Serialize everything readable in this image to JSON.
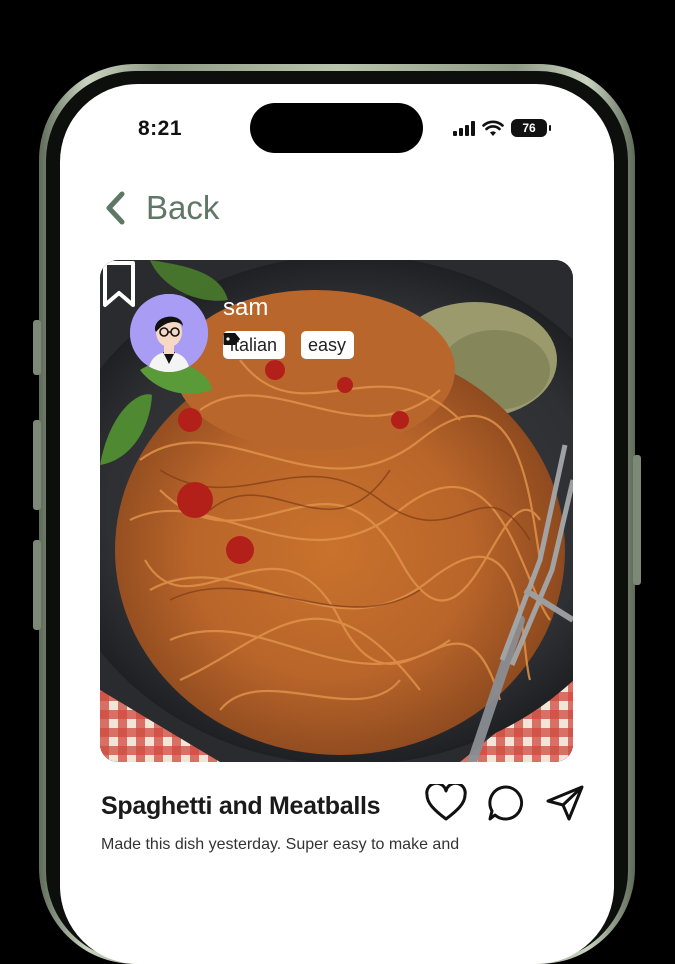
{
  "status_bar": {
    "time": "8:21",
    "battery_level": "76",
    "icons": [
      "cellular-signal-icon",
      "wifi-icon",
      "battery-icon"
    ]
  },
  "nav": {
    "back_label": "Back",
    "back_icon": "chevron-left-icon"
  },
  "post": {
    "author": "sam",
    "tags": [
      {
        "label": "italian",
        "icon": "tag-icon"
      },
      {
        "label": "easy",
        "icon": "tag-icon"
      }
    ],
    "bookmark_icon": "bookmark-icon",
    "image_description_icon": "food-photo",
    "title": "Spaghetti and Meatballs",
    "caption": "Made this dish yesterday. Super easy to make and",
    "actions": [
      "heart-icon",
      "comment-icon",
      "send-icon"
    ]
  },
  "colors": {
    "accent": "#5f7766",
    "avatar_bg": "#a99cf5",
    "background": "#ffffff",
    "frame": "#b9c4ae"
  }
}
